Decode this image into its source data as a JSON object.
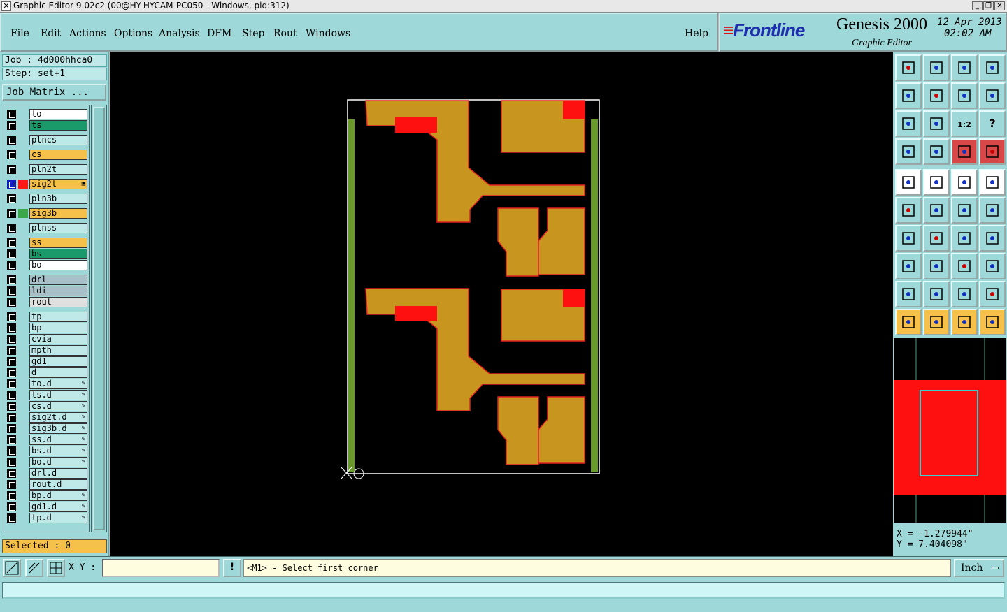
{
  "window": {
    "title": "Graphic Editor 9.02c2 (00@HY-HYCAM-PC050 - Windows, pid:312)",
    "controls": [
      "_",
      "❐",
      "✕"
    ]
  },
  "menu": {
    "items": [
      "File",
      "Edit",
      "Actions",
      "Options",
      "Analysis",
      "DFM",
      "Step",
      "Rout",
      "Windows"
    ],
    "help": "Help"
  },
  "brand": {
    "logo": "Frontline",
    "product": "Genesis 2000",
    "subtitle": "Graphic Editor",
    "date": "12 Apr 2013",
    "time": "02:02 AM"
  },
  "job": {
    "job_label": "Job : 4d000hhca0",
    "step_label": "Step: set+1",
    "job_matrix": "Job Matrix ..."
  },
  "layers": [
    {
      "name": "to",
      "color": "#ffffff",
      "swatch": "",
      "mark": ""
    },
    {
      "name": "ts",
      "color": "#1a9a6a",
      "swatch": "",
      "mark": ""
    },
    {
      "name": "plncs",
      "color": "#bfe9e9",
      "swatch": "",
      "mark": ""
    },
    {
      "name": "cs",
      "color": "#f5c14a",
      "swatch": "",
      "mark": ""
    },
    {
      "name": "pln2t",
      "color": "#bfe9e9",
      "swatch": "",
      "mark": ""
    },
    {
      "name": "sig2t",
      "color": "#f5c14a",
      "swatch": "#ff1a1a",
      "mark": "▣",
      "active": true
    },
    {
      "name": "pln3b",
      "color": "#bfe9e9",
      "swatch": "",
      "mark": ""
    },
    {
      "name": "sig3b",
      "color": "#f5c14a",
      "swatch": "#3aa84a",
      "mark": ""
    },
    {
      "name": "plnss",
      "color": "#bfe9e9",
      "swatch": "",
      "mark": ""
    },
    {
      "name": "ss",
      "color": "#f5c14a",
      "swatch": "",
      "mark": ""
    },
    {
      "name": "bs",
      "color": "#1a9a6a",
      "swatch": "",
      "mark": ""
    },
    {
      "name": "bo",
      "color": "#ffffff",
      "swatch": "",
      "mark": ""
    },
    {
      "name": "drl",
      "color": "#a8c0c8",
      "swatch": "",
      "mark": ""
    },
    {
      "name": "ldi",
      "color": "#a8c0c8",
      "swatch": "",
      "mark": ""
    },
    {
      "name": "rout",
      "color": "#e0e0e0",
      "swatch": "",
      "mark": ""
    },
    {
      "name": "tp",
      "color": "#bfe9e9",
      "swatch": "",
      "mark": ""
    },
    {
      "name": "bp",
      "color": "#bfe9e9",
      "swatch": "",
      "mark": ""
    },
    {
      "name": "cvia",
      "color": "#bfe9e9",
      "swatch": "",
      "mark": ""
    },
    {
      "name": "mpth",
      "color": "#bfe9e9",
      "swatch": "",
      "mark": ""
    },
    {
      "name": "gd1",
      "color": "#bfe9e9",
      "swatch": "",
      "mark": ""
    },
    {
      "name": "d",
      "color": "#bfe9e9",
      "swatch": "",
      "mark": ""
    },
    {
      "name": "to.d",
      "color": "#bfe9e9",
      "swatch": "",
      "mark": "✎"
    },
    {
      "name": "ts.d",
      "color": "#bfe9e9",
      "swatch": "",
      "mark": "✎"
    },
    {
      "name": "cs.d",
      "color": "#bfe9e9",
      "swatch": "",
      "mark": "✎"
    },
    {
      "name": "sig2t.d",
      "color": "#bfe9e9",
      "swatch": "",
      "mark": "✎"
    },
    {
      "name": "sig3b.d",
      "color": "#bfe9e9",
      "swatch": "",
      "mark": "✎"
    },
    {
      "name": "ss.d",
      "color": "#bfe9e9",
      "swatch": "",
      "mark": "✎"
    },
    {
      "name": "bs.d",
      "color": "#bfe9e9",
      "swatch": "",
      "mark": "✎"
    },
    {
      "name": "bo.d",
      "color": "#bfe9e9",
      "swatch": "",
      "mark": "✎"
    },
    {
      "name": "drl.d",
      "color": "#bfe9e9",
      "swatch": "",
      "mark": ""
    },
    {
      "name": "rout.d",
      "color": "#bfe9e9",
      "swatch": "",
      "mark": ""
    },
    {
      "name": "bp.d",
      "color": "#bfe9e9",
      "swatch": "",
      "mark": "✎"
    },
    {
      "name": "gd1.d",
      "color": "#bfe9e9",
      "swatch": "",
      "mark": "✎"
    },
    {
      "name": "tp.d",
      "color": "#bfe9e9",
      "swatch": "",
      "mark": "✎"
    }
  ],
  "selection": {
    "label": "Selected : 0"
  },
  "toolbox": {
    "tools": [
      {
        "name": "zoom-home-icon",
        "style": ""
      },
      {
        "name": "zoom-down-icon",
        "style": ""
      },
      {
        "name": "home-icon",
        "style": ""
      },
      {
        "name": "window-split-icon",
        "style": ""
      },
      {
        "name": "pan-left-icon",
        "style": ""
      },
      {
        "name": "pan-right-icon",
        "style": ""
      },
      {
        "name": "undo-zoom-icon",
        "style": ""
      },
      {
        "name": "snake-icon",
        "style": ""
      },
      {
        "name": "fit-page-icon",
        "style": ""
      },
      {
        "name": "fit-profile-icon",
        "style": ""
      },
      {
        "name": "one-to-two-icon",
        "style": ""
      },
      {
        "name": "help-icon",
        "style": ""
      },
      {
        "name": "settings-icon",
        "style": ""
      },
      {
        "name": "pad-icon",
        "style": ""
      },
      {
        "name": "net-highlight-icon",
        "style": "red"
      },
      {
        "name": "net-select-icon",
        "style": "red"
      },
      {
        "name": "fill-icon",
        "style": "light"
      },
      {
        "name": "draw-shape-icon",
        "style": "light"
      },
      {
        "name": "ruler-icon",
        "style": "light"
      },
      {
        "name": "pad-select-icon",
        "style": "light"
      },
      {
        "name": "connect-icon",
        "style": ""
      },
      {
        "name": "delete-node-icon",
        "style": ""
      },
      {
        "name": "add-segment-icon",
        "style": ""
      },
      {
        "name": "move-node-icon",
        "style": ""
      },
      {
        "name": "angle-icon",
        "style": ""
      },
      {
        "name": "line-icon",
        "style": ""
      },
      {
        "name": "arc-icon",
        "style": ""
      },
      {
        "name": "mirror-icon",
        "style": ""
      },
      {
        "name": "pad-move-icon",
        "style": ""
      },
      {
        "name": "horizontal-line-icon",
        "style": ""
      },
      {
        "name": "measure-icon",
        "style": ""
      },
      {
        "name": "shapes-icon",
        "style": ""
      },
      {
        "name": "triangle-icon",
        "style": ""
      },
      {
        "name": "triangle-select-icon",
        "style": ""
      },
      {
        "name": "triangle-edit-icon",
        "style": ""
      },
      {
        "name": "triangle-cross-icon",
        "style": ""
      },
      {
        "name": "pointer-icon",
        "style": "yellow"
      },
      {
        "name": "pointer-box-icon",
        "style": "yellow"
      },
      {
        "name": "pointer-frame-icon",
        "style": "yellow"
      },
      {
        "name": "route-select-icon",
        "style": "yellow"
      }
    ]
  },
  "coords": {
    "x": "X = -1.279944\"",
    "y": "Y = 7.404098\""
  },
  "bottom": {
    "xy_label": "X Y :",
    "xy_value": "",
    "excl": "!",
    "prompt": "<M1> - Select first corner",
    "units": "Inch"
  },
  "message": ""
}
